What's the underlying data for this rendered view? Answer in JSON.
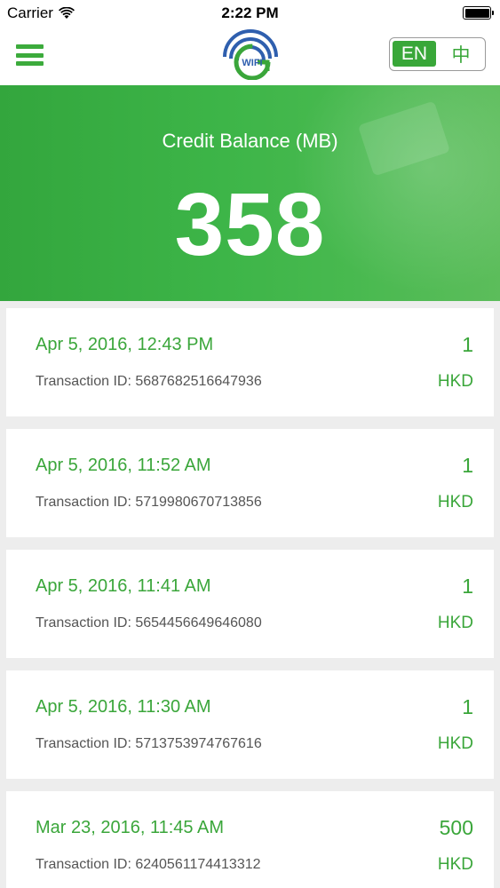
{
  "status_bar": {
    "carrier": "Carrier",
    "time": "2:22 PM"
  },
  "nav": {
    "logo_text": "WIFI",
    "lang_en": "EN",
    "lang_zh": "中"
  },
  "hero": {
    "label": "Credit Balance (MB)",
    "value": "358"
  },
  "transactions": [
    {
      "date": "Apr 5, 2016, 12:43 PM",
      "txn": "Transaction ID: 5687682516647936",
      "amount": "1",
      "currency": "HKD"
    },
    {
      "date": "Apr 5, 2016, 11:52 AM",
      "txn": "Transaction ID: 5719980670713856",
      "amount": "1",
      "currency": "HKD"
    },
    {
      "date": "Apr 5, 2016, 11:41 AM",
      "txn": "Transaction ID: 5654456649646080",
      "amount": "1",
      "currency": "HKD"
    },
    {
      "date": "Apr 5, 2016, 11:30 AM",
      "txn": "Transaction ID: 5713753974767616",
      "amount": "1",
      "currency": "HKD"
    },
    {
      "date": "Mar 23, 2016, 11:45 AM",
      "txn": "Transaction ID: 6240561174413312",
      "amount": "500",
      "currency": "HKD"
    }
  ],
  "colors": {
    "accent": "#3aa63a",
    "background": "#ededed"
  }
}
